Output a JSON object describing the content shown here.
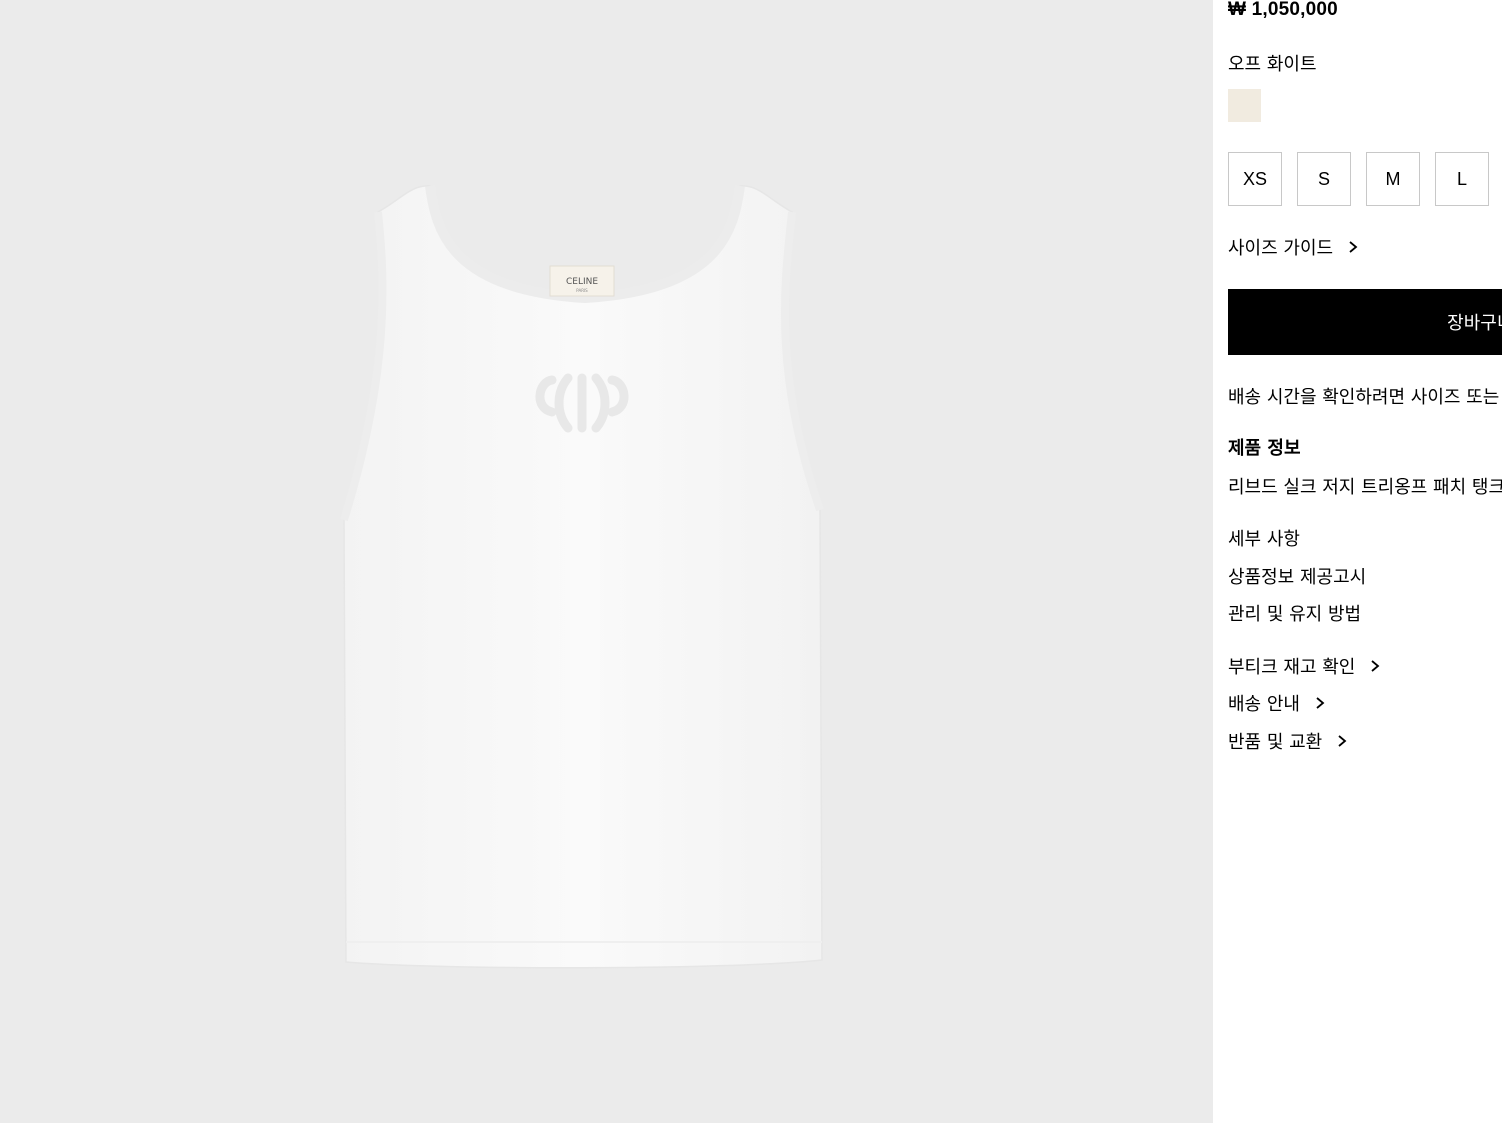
{
  "product": {
    "price": "₩ 1,050,000",
    "color_name": "오프 화이트",
    "swatch_color": "#f1ebe0",
    "sizes": [
      "XS",
      "S",
      "M",
      "L"
    ],
    "size_guide": "사이즈 가이드",
    "add_to_cart": "장바구니에 추가",
    "delivery_note": "배송 시간을 확인하려면 사이즈 또는 색상을 선택하세요",
    "info_title": "제품 정보",
    "description": "리브드 실크 저지 트리옹프 패치 탱크 탑",
    "details": [
      "세부 사항",
      "상품정보 제공고시",
      "관리 및 유지 방법"
    ],
    "links": [
      "부티크 재고 확인",
      "배송 안내",
      "반품 및 교환"
    ],
    "image_logo_text": "CELINE",
    "image_logo_sub": "PARIS"
  }
}
